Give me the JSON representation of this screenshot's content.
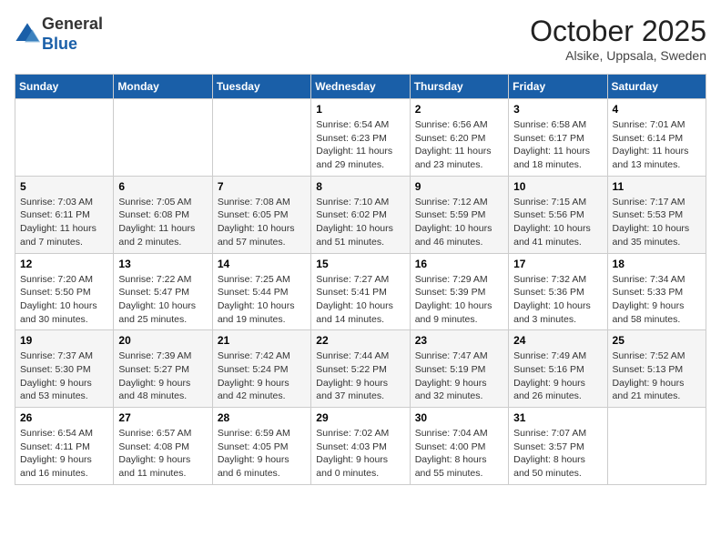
{
  "header": {
    "logo_general": "General",
    "logo_blue": "Blue",
    "month_title": "October 2025",
    "subtitle": "Alsike, Uppsala, Sweden"
  },
  "days_of_week": [
    "Sunday",
    "Monday",
    "Tuesday",
    "Wednesday",
    "Thursday",
    "Friday",
    "Saturday"
  ],
  "weeks": [
    [
      {
        "day": "",
        "info": ""
      },
      {
        "day": "",
        "info": ""
      },
      {
        "day": "",
        "info": ""
      },
      {
        "day": "1",
        "info": "Sunrise: 6:54 AM\nSunset: 6:23 PM\nDaylight: 11 hours\nand 29 minutes."
      },
      {
        "day": "2",
        "info": "Sunrise: 6:56 AM\nSunset: 6:20 PM\nDaylight: 11 hours\nand 23 minutes."
      },
      {
        "day": "3",
        "info": "Sunrise: 6:58 AM\nSunset: 6:17 PM\nDaylight: 11 hours\nand 18 minutes."
      },
      {
        "day": "4",
        "info": "Sunrise: 7:01 AM\nSunset: 6:14 PM\nDaylight: 11 hours\nand 13 minutes."
      }
    ],
    [
      {
        "day": "5",
        "info": "Sunrise: 7:03 AM\nSunset: 6:11 PM\nDaylight: 11 hours\nand 7 minutes."
      },
      {
        "day": "6",
        "info": "Sunrise: 7:05 AM\nSunset: 6:08 PM\nDaylight: 11 hours\nand 2 minutes."
      },
      {
        "day": "7",
        "info": "Sunrise: 7:08 AM\nSunset: 6:05 PM\nDaylight: 10 hours\nand 57 minutes."
      },
      {
        "day": "8",
        "info": "Sunrise: 7:10 AM\nSunset: 6:02 PM\nDaylight: 10 hours\nand 51 minutes."
      },
      {
        "day": "9",
        "info": "Sunrise: 7:12 AM\nSunset: 5:59 PM\nDaylight: 10 hours\nand 46 minutes."
      },
      {
        "day": "10",
        "info": "Sunrise: 7:15 AM\nSunset: 5:56 PM\nDaylight: 10 hours\nand 41 minutes."
      },
      {
        "day": "11",
        "info": "Sunrise: 7:17 AM\nSunset: 5:53 PM\nDaylight: 10 hours\nand 35 minutes."
      }
    ],
    [
      {
        "day": "12",
        "info": "Sunrise: 7:20 AM\nSunset: 5:50 PM\nDaylight: 10 hours\nand 30 minutes."
      },
      {
        "day": "13",
        "info": "Sunrise: 7:22 AM\nSunset: 5:47 PM\nDaylight: 10 hours\nand 25 minutes."
      },
      {
        "day": "14",
        "info": "Sunrise: 7:25 AM\nSunset: 5:44 PM\nDaylight: 10 hours\nand 19 minutes."
      },
      {
        "day": "15",
        "info": "Sunrise: 7:27 AM\nSunset: 5:41 PM\nDaylight: 10 hours\nand 14 minutes."
      },
      {
        "day": "16",
        "info": "Sunrise: 7:29 AM\nSunset: 5:39 PM\nDaylight: 10 hours\nand 9 minutes."
      },
      {
        "day": "17",
        "info": "Sunrise: 7:32 AM\nSunset: 5:36 PM\nDaylight: 10 hours\nand 3 minutes."
      },
      {
        "day": "18",
        "info": "Sunrise: 7:34 AM\nSunset: 5:33 PM\nDaylight: 9 hours\nand 58 minutes."
      }
    ],
    [
      {
        "day": "19",
        "info": "Sunrise: 7:37 AM\nSunset: 5:30 PM\nDaylight: 9 hours\nand 53 minutes."
      },
      {
        "day": "20",
        "info": "Sunrise: 7:39 AM\nSunset: 5:27 PM\nDaylight: 9 hours\nand 48 minutes."
      },
      {
        "day": "21",
        "info": "Sunrise: 7:42 AM\nSunset: 5:24 PM\nDaylight: 9 hours\nand 42 minutes."
      },
      {
        "day": "22",
        "info": "Sunrise: 7:44 AM\nSunset: 5:22 PM\nDaylight: 9 hours\nand 37 minutes."
      },
      {
        "day": "23",
        "info": "Sunrise: 7:47 AM\nSunset: 5:19 PM\nDaylight: 9 hours\nand 32 minutes."
      },
      {
        "day": "24",
        "info": "Sunrise: 7:49 AM\nSunset: 5:16 PM\nDaylight: 9 hours\nand 26 minutes."
      },
      {
        "day": "25",
        "info": "Sunrise: 7:52 AM\nSunset: 5:13 PM\nDaylight: 9 hours\nand 21 minutes."
      }
    ],
    [
      {
        "day": "26",
        "info": "Sunrise: 6:54 AM\nSunset: 4:11 PM\nDaylight: 9 hours\nand 16 minutes."
      },
      {
        "day": "27",
        "info": "Sunrise: 6:57 AM\nSunset: 4:08 PM\nDaylight: 9 hours\nand 11 minutes."
      },
      {
        "day": "28",
        "info": "Sunrise: 6:59 AM\nSunset: 4:05 PM\nDaylight: 9 hours\nand 6 minutes."
      },
      {
        "day": "29",
        "info": "Sunrise: 7:02 AM\nSunset: 4:03 PM\nDaylight: 9 hours\nand 0 minutes."
      },
      {
        "day": "30",
        "info": "Sunrise: 7:04 AM\nSunset: 4:00 PM\nDaylight: 8 hours\nand 55 minutes."
      },
      {
        "day": "31",
        "info": "Sunrise: 7:07 AM\nSunset: 3:57 PM\nDaylight: 8 hours\nand 50 minutes."
      },
      {
        "day": "",
        "info": ""
      }
    ]
  ]
}
